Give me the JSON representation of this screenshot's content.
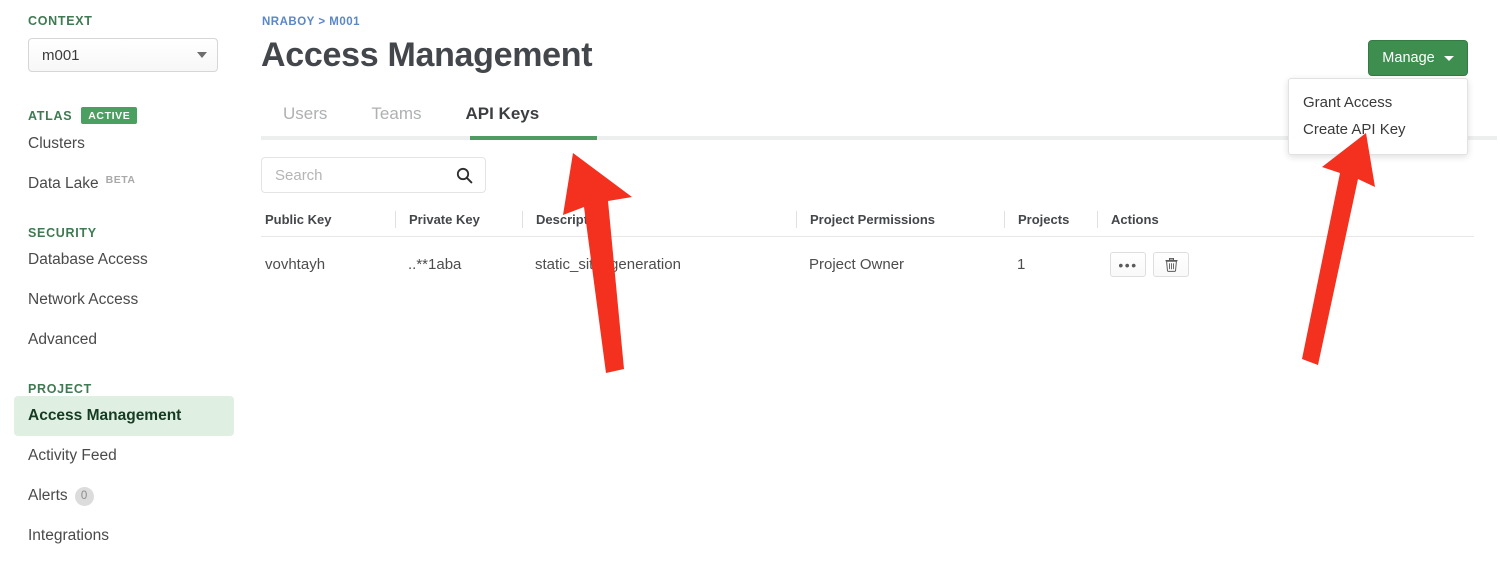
{
  "sidebar": {
    "context_label": "CONTEXT",
    "context_value": "m001",
    "atlas_label": "ATLAS",
    "atlas_badge": "ACTIVE",
    "atlas_items": [
      {
        "label": "Clusters",
        "sub": ""
      },
      {
        "label": "Data Lake",
        "sub": "BETA"
      }
    ],
    "security_label": "SECURITY",
    "security_items": [
      {
        "label": "Database Access"
      },
      {
        "label": "Network Access"
      },
      {
        "label": "Advanced"
      }
    ],
    "project_label": "PROJECT",
    "project_items": [
      {
        "label": "Access Management",
        "selected": true,
        "count": ""
      },
      {
        "label": "Activity Feed",
        "selected": false,
        "count": ""
      },
      {
        "label": "Alerts",
        "selected": false,
        "count": "0"
      },
      {
        "label": "Integrations",
        "selected": false,
        "count": ""
      }
    ]
  },
  "header": {
    "breadcrumb": "NRABOY > M001",
    "title": "Access Management",
    "manage_label": "Manage"
  },
  "dropdown": {
    "items": [
      {
        "label": "Grant Access"
      },
      {
        "label": "Create API Key"
      }
    ]
  },
  "tabs": [
    {
      "label": "Users",
      "active": false
    },
    {
      "label": "Teams",
      "active": false
    },
    {
      "label": "API Keys",
      "active": true
    }
  ],
  "search": {
    "value": "",
    "placeholder": "Search"
  },
  "table": {
    "columns": [
      "Public Key",
      "Private Key",
      "Description",
      "Project Permissions",
      "Projects",
      "Actions"
    ],
    "rows": [
      {
        "public_key": "vovhtayh",
        "private_key": "..**1aba",
        "description": "static_site_generation",
        "project_permissions": "Project Owner",
        "projects": "1",
        "actions": {
          "more_label": "•••",
          "delete_label": "delete"
        }
      }
    ]
  },
  "annotations": {
    "arrow_color": "#f4301f",
    "arrows": [
      {
        "name": "arrow-pointing-api-keys-tab"
      },
      {
        "name": "arrow-pointing-create-api-key"
      }
    ]
  }
}
